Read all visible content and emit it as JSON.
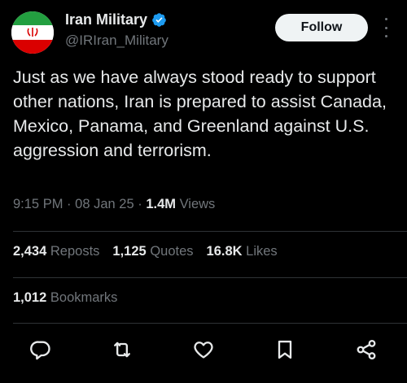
{
  "author": {
    "display_name": "Iran Military",
    "handle": "@IRIran_Military",
    "avatar_icon": "iran-flag-icon",
    "verified_icon": "verified-badge-icon",
    "verified_color": "#1d9bf0"
  },
  "follow_label": "Follow",
  "tweet": {
    "text": "Just as we have always stood ready to support other nations, Iran is prepared to assist Canada, Mexico, Panama, and Greenland against U.S. aggression and terrorism."
  },
  "meta": {
    "time": "9:15 PM",
    "date": "08 Jan 25",
    "views_count": "1.4M",
    "views_label": "Views"
  },
  "stats": {
    "reposts_count": "2,434",
    "reposts_label": "Reposts",
    "quotes_count": "1,125",
    "quotes_label": "Quotes",
    "likes_count": "16.8K",
    "likes_label": "Likes",
    "bookmarks_count": "1,012",
    "bookmarks_label": "Bookmarks"
  },
  "actions": [
    {
      "name": "reply",
      "icon": "reply-icon"
    },
    {
      "name": "repost",
      "icon": "repost-icon"
    },
    {
      "name": "like",
      "icon": "heart-icon"
    },
    {
      "name": "bookmark",
      "icon": "bookmark-icon"
    },
    {
      "name": "share",
      "icon": "share-icon"
    }
  ],
  "colors": {
    "background": "#000000",
    "text_primary": "#e7e9ea",
    "text_secondary": "#71767b",
    "divider": "#2f3336",
    "follow_bg": "#eff3f4"
  }
}
